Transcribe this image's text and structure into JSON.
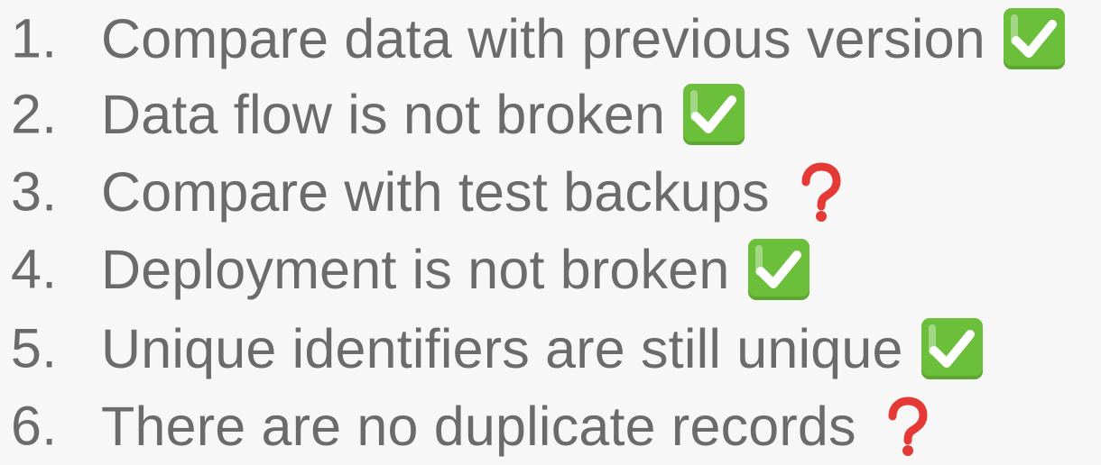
{
  "checklist": {
    "items": [
      {
        "number": "1.",
        "text": "Compare data with previous version",
        "status": "check",
        "status_icon": "green-check-box-icon"
      },
      {
        "number": "2.",
        "text": "Data flow is not broken",
        "status": "check",
        "status_icon": "green-check-box-icon"
      },
      {
        "number": "3.",
        "text": "Compare with test backups",
        "status": "question",
        "status_icon": "red-question-mark-icon"
      },
      {
        "number": "4.",
        "text": "Deployment is not broken",
        "status": "check",
        "status_icon": "green-check-box-icon"
      },
      {
        "number": "5.",
        "text": "Unique identifiers are still unique",
        "status": "check",
        "status_icon": "green-check-box-icon"
      },
      {
        "number": "6.",
        "text": "There are no duplicate records",
        "status": "question",
        "status_icon": "red-question-mark-icon"
      }
    ]
  },
  "colors": {
    "background": "#f7f7f7",
    "text": "#6b6b6b",
    "check_green": "#6bbf3a",
    "question_red": "#e53935"
  }
}
